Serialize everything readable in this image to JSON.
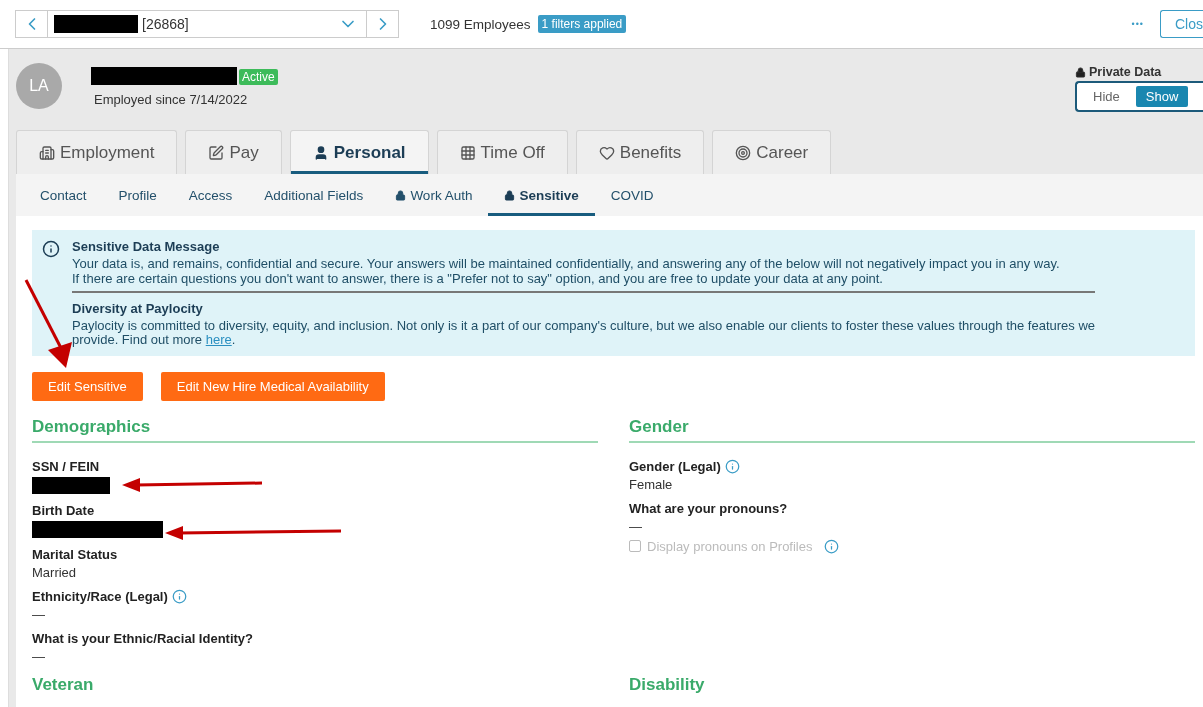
{
  "employee_selector": {
    "name_redacted": true,
    "id": "[26868]"
  },
  "employee_count": "1099 Employees",
  "filter_badge": "1 filters applied",
  "more_menu": "•••",
  "close_button": "Clos",
  "profile": {
    "initials": "LA",
    "name_redacted": true,
    "status": "Active",
    "employed_since": "Employed since 7/14/2022"
  },
  "private_data": {
    "label": "Private Data",
    "options": [
      {
        "label": "Hide",
        "selected": false
      },
      {
        "label": "Show",
        "selected": true
      }
    ]
  },
  "tabs": [
    {
      "label": "Employment",
      "selected": false
    },
    {
      "label": "Pay",
      "selected": false
    },
    {
      "label": "Personal",
      "selected": true
    },
    {
      "label": "Time Off",
      "selected": false
    },
    {
      "label": "Benefits",
      "selected": false
    },
    {
      "label": "Career",
      "selected": false
    }
  ],
  "subtabs": [
    {
      "label": "Contact",
      "locked": false,
      "selected": false
    },
    {
      "label": "Profile",
      "locked": false,
      "selected": false
    },
    {
      "label": "Access",
      "locked": false,
      "selected": false
    },
    {
      "label": "Additional Fields",
      "locked": false,
      "selected": false
    },
    {
      "label": "Work Auth",
      "locked": true,
      "selected": false
    },
    {
      "label": "Sensitive",
      "locked": true,
      "selected": true
    },
    {
      "label": "COVID",
      "locked": false,
      "selected": false
    }
  ],
  "info_box": {
    "title": "Sensitive Data Message",
    "lines": [
      "Your data is, and remains, confidential and secure. Your answers will be maintained confidentially, and answering any of the below will not negatively impact you in any way.",
      "If there are certain questions you don't want to answer, there is a \"Prefer not to say\" option, and you are free to update your data at any point."
    ],
    "title_2": "Diversity at Paylocity",
    "text_2": "Paylocity is committed to diversity, equity, and inclusion. Not only is it a part of our company's culture, but we also enable our clients to foster these values through the features we provide. Find out more",
    "link": "here",
    "text_2_end": "."
  },
  "buttons": [
    "Edit Sensitive",
    "Edit New Hire Medical Availability"
  ],
  "sections": [
    {
      "title": "Demographics",
      "fields": [
        {
          "label": "SSN / FEIN",
          "info": false,
          "redacted": true,
          "arrow": true
        },
        {
          "label": "Birth Date",
          "info": false,
          "redacted": true,
          "arrow": true
        },
        {
          "label": "Marital Status",
          "info": false,
          "value": "Married"
        },
        {
          "label": "Ethnicity/Race (Legal)",
          "info": true,
          "value": "—"
        },
        {
          "label": "What is your Ethnic/Racial Identity?",
          "info": false,
          "value": "—"
        }
      ]
    },
    {
      "title": "Gender",
      "fields": [
        {
          "label": "Gender (Legal)",
          "info": true,
          "value": "Female"
        },
        {
          "label": "What are your pronouns?",
          "info": false,
          "value": "—",
          "checkbox": {
            "label": "Display pronouns on Profiles",
            "checked": false,
            "disabled": true
          }
        }
      ]
    }
  ],
  "next_sections": [
    "Veteran",
    "Disability"
  ]
}
